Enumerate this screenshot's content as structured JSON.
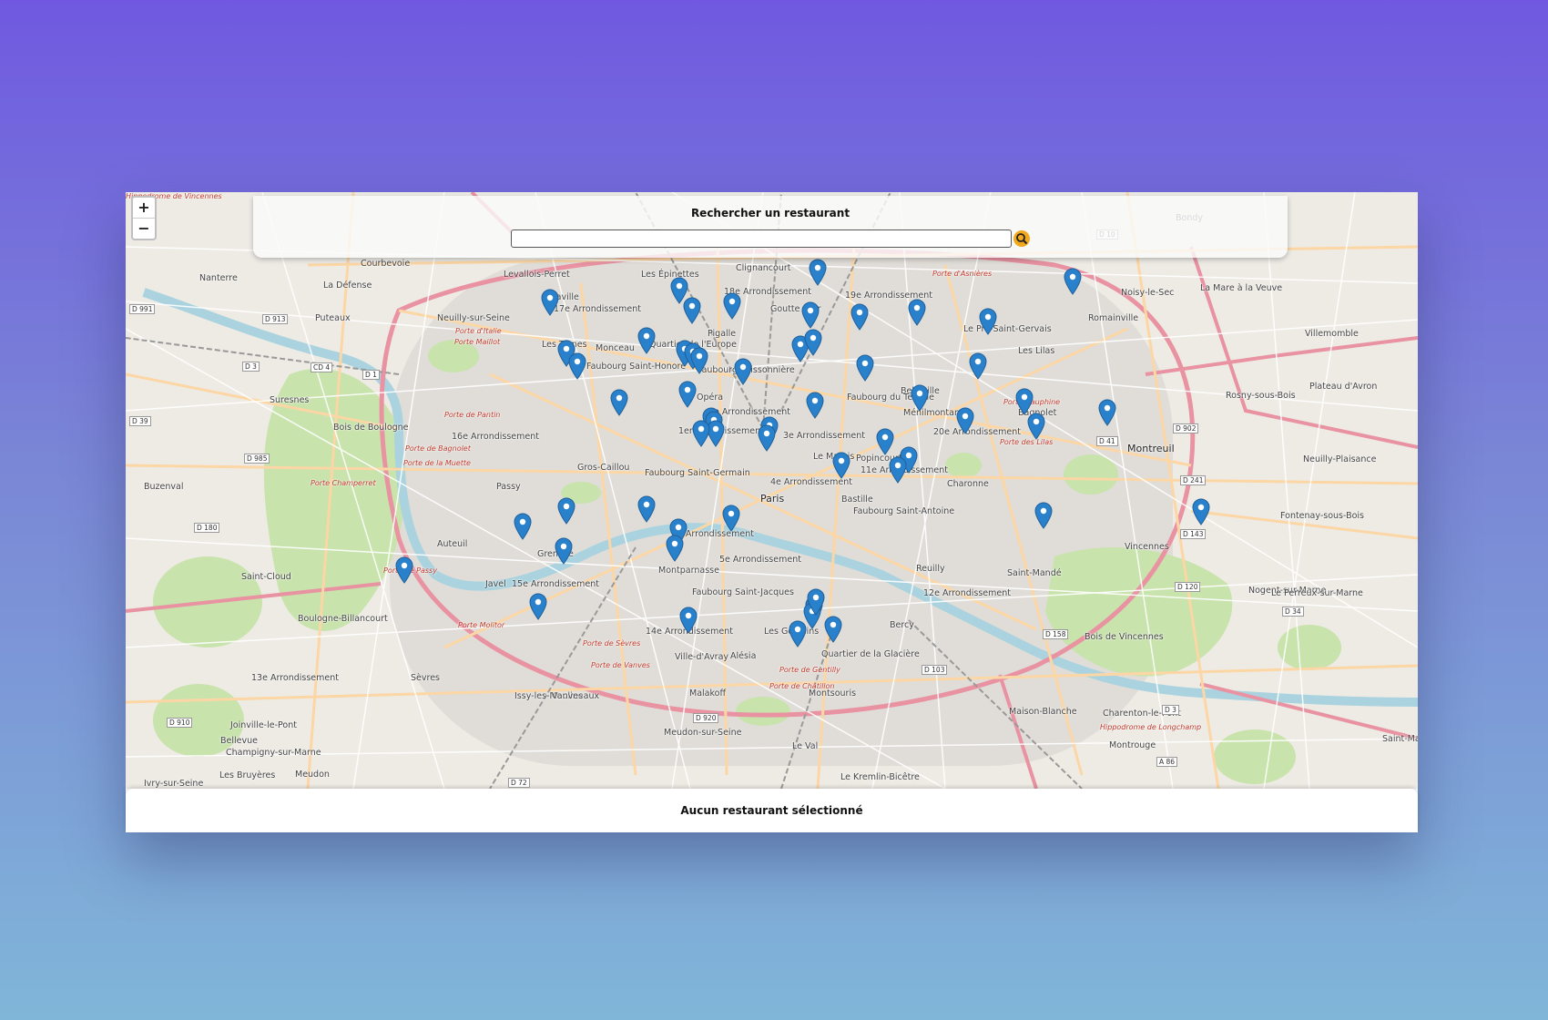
{
  "search": {
    "title": "Rechercher un restaurant",
    "value": "",
    "placeholder": ""
  },
  "zoom": {
    "in_label": "+",
    "out_label": "−"
  },
  "status": {
    "text": "Aucun restaurant sélectionné"
  },
  "colors": {
    "marker": "#2a81cb",
    "search_button": "#f2a81d",
    "park": "#cde6b0",
    "water": "#aad3df",
    "highway": "#e892a2",
    "primary_road": "#fcd6a4"
  },
  "map_labels": [
    {
      "text": "Courbevoie",
      "cls": ""
    },
    {
      "text": "Levallois-Perret",
      "cls": ""
    },
    {
      "text": "Les Épinettes",
      "cls": ""
    },
    {
      "text": "Clignancourt",
      "cls": ""
    },
    {
      "text": "18e Arrondissement",
      "cls": ""
    },
    {
      "text": "19e Arrondissement",
      "cls": ""
    },
    {
      "text": "Noisy-le-Sec",
      "cls": ""
    },
    {
      "text": "Bondy",
      "cls": ""
    },
    {
      "text": "Nanterre",
      "cls": ""
    },
    {
      "text": "La Défense",
      "cls": ""
    },
    {
      "text": "Puteaux",
      "cls": ""
    },
    {
      "text": "Neuilly-sur-Seine",
      "cls": ""
    },
    {
      "text": "17e Arrondissement",
      "cls": ""
    },
    {
      "text": "Goutte d'Or",
      "cls": ""
    },
    {
      "text": "Pigalle",
      "cls": ""
    },
    {
      "text": "Le Pré-Saint-Gervais",
      "cls": ""
    },
    {
      "text": "Romainville",
      "cls": ""
    },
    {
      "text": "La Mare à la Veuve",
      "cls": ""
    },
    {
      "text": "Villemomble",
      "cls": ""
    },
    {
      "text": "Les Ternes",
      "cls": ""
    },
    {
      "text": "Monceau",
      "cls": ""
    },
    {
      "text": "Quartier de l'Europe",
      "cls": ""
    },
    {
      "text": "Les Lilas",
      "cls": ""
    },
    {
      "text": "Faubourg Saint-Honoré",
      "cls": ""
    },
    {
      "text": "Faubourg Poissonnière",
      "cls": ""
    },
    {
      "text": "Belleville",
      "cls": ""
    },
    {
      "text": "Opéra",
      "cls": ""
    },
    {
      "text": "Suresnes",
      "cls": ""
    },
    {
      "text": "Faubourg du Temple",
      "cls": ""
    },
    {
      "text": "Ménilmontant",
      "cls": ""
    },
    {
      "text": "Bagnolet",
      "cls": ""
    },
    {
      "text": "Rosny-sous-Bois",
      "cls": ""
    },
    {
      "text": "Plateau d'Avron",
      "cls": ""
    },
    {
      "text": "2e Arrondissement",
      "cls": ""
    },
    {
      "text": "1er Arrondissement",
      "cls": ""
    },
    {
      "text": "3e Arrondissement",
      "cls": ""
    },
    {
      "text": "20e Arrondissement",
      "cls": ""
    },
    {
      "text": "Montreuil",
      "cls": "dark"
    },
    {
      "text": "Bois de Boulogne",
      "cls": ""
    },
    {
      "text": "16e Arrondissement",
      "cls": ""
    },
    {
      "text": "Le Marais",
      "cls": ""
    },
    {
      "text": "Popincourt",
      "cls": ""
    },
    {
      "text": "11e Arrondissement",
      "cls": ""
    },
    {
      "text": "Neuilly-Plaisance",
      "cls": ""
    },
    {
      "text": "Buzenval",
      "cls": ""
    },
    {
      "text": "Gros-Caillou",
      "cls": ""
    },
    {
      "text": "Passy",
      "cls": ""
    },
    {
      "text": "Faubourg Saint-Germain",
      "cls": ""
    },
    {
      "text": "4e Arrondissement",
      "cls": ""
    },
    {
      "text": "Paris",
      "cls": "dark"
    },
    {
      "text": "Bastille",
      "cls": ""
    },
    {
      "text": "Charonne",
      "cls": ""
    },
    {
      "text": "Faubourg Saint-Antoine",
      "cls": ""
    },
    {
      "text": "Fontenay-sous-Bois",
      "cls": ""
    },
    {
      "text": "6e Arrondissement",
      "cls": ""
    },
    {
      "text": "Auteuil",
      "cls": ""
    },
    {
      "text": "Grenelle",
      "cls": ""
    },
    {
      "text": "5e Arrondissement",
      "cls": ""
    },
    {
      "text": "Vincennes",
      "cls": ""
    },
    {
      "text": "Saint-Cloud",
      "cls": ""
    },
    {
      "text": "Montparnasse",
      "cls": ""
    },
    {
      "text": "Reuilly",
      "cls": ""
    },
    {
      "text": "Saint-Mandé",
      "cls": ""
    },
    {
      "text": "Javel",
      "cls": ""
    },
    {
      "text": "15e Arrondissement",
      "cls": ""
    },
    {
      "text": "Faubourg Saint-Jacques",
      "cls": ""
    },
    {
      "text": "12e Arrondissement",
      "cls": ""
    },
    {
      "text": "Nogent-sur-Marne",
      "cls": ""
    },
    {
      "text": "Le Perreux-sur-Marne",
      "cls": ""
    },
    {
      "text": "Boulogne-Billancourt",
      "cls": ""
    },
    {
      "text": "Bercy",
      "cls": ""
    },
    {
      "text": "Bois de Vincennes",
      "cls": ""
    },
    {
      "text": "14e Arrondissement",
      "cls": ""
    },
    {
      "text": "Les Gobelins",
      "cls": ""
    },
    {
      "text": "Ville-d'Avray",
      "cls": ""
    },
    {
      "text": "Alésia",
      "cls": ""
    },
    {
      "text": "Quartier de la Glacière",
      "cls": ""
    },
    {
      "text": "13e Arrondissement",
      "cls": ""
    },
    {
      "text": "Sèvres",
      "cls": ""
    },
    {
      "text": "Issy-les-Moulineaux",
      "cls": ""
    },
    {
      "text": "Vanves",
      "cls": ""
    },
    {
      "text": "Malakoff",
      "cls": ""
    },
    {
      "text": "Montsouris",
      "cls": ""
    },
    {
      "text": "Maison-Blanche",
      "cls": ""
    },
    {
      "text": "Charenton-le-Pont",
      "cls": ""
    },
    {
      "text": "Joinville-le-Pont",
      "cls": ""
    },
    {
      "text": "Bellevue",
      "cls": ""
    },
    {
      "text": "Meudon-sur-Seine",
      "cls": ""
    },
    {
      "text": "Montrouge",
      "cls": ""
    },
    {
      "text": "Saint-Maurice",
      "cls": ""
    },
    {
      "text": "Champigny-sur-Marne",
      "cls": ""
    },
    {
      "text": "Les Bruyères",
      "cls": ""
    },
    {
      "text": "Meudon",
      "cls": ""
    },
    {
      "text": "Le Val",
      "cls": ""
    },
    {
      "text": "Le Kremlin-Bicêtre",
      "cls": ""
    },
    {
      "text": "Ivry-sur-Seine",
      "cls": ""
    },
    {
      "text": "Chaville",
      "cls": ""
    },
    {
      "text": "Porte d'Asnières",
      "cls": "red"
    },
    {
      "text": "Porte de Pantin",
      "cls": "red"
    },
    {
      "text": "Porte Dauphine",
      "cls": "red"
    },
    {
      "text": "Porte des Lilas",
      "cls": "red"
    },
    {
      "text": "Porte de Bagnolet",
      "cls": "red"
    },
    {
      "text": "Porte de la Muette",
      "cls": "red"
    },
    {
      "text": "Porte de Passy",
      "cls": "red"
    },
    {
      "text": "Porte Molitor",
      "cls": "red"
    },
    {
      "text": "Porte de Sèvres",
      "cls": "red"
    },
    {
      "text": "Porte de Vanves",
      "cls": "red"
    },
    {
      "text": "Porte de Châtillon",
      "cls": "red"
    },
    {
      "text": "Porte de Gentilly",
      "cls": "red"
    },
    {
      "text": "Porte d'Italie",
      "cls": "red"
    },
    {
      "text": "Porte Maillot",
      "cls": "red"
    },
    {
      "text": "Porte Champerret",
      "cls": "red"
    },
    {
      "text": "Hippodrome de Longchamp",
      "cls": "red"
    },
    {
      "text": "Hippodrome de Vincennes",
      "cls": "red"
    }
  ],
  "road_tags": [
    "D 913",
    "D 991",
    "D 3",
    "CD 4",
    "D 1",
    "D 39",
    "D 985",
    "D 180",
    "D 910",
    "D 10",
    "D 902",
    "D 41",
    "D 241",
    "D 143",
    "D 120",
    "D 158",
    "D 103",
    "D 34",
    "D 3",
    "A 86",
    "D 72",
    "D 920"
  ],
  "markers_count": 56
}
